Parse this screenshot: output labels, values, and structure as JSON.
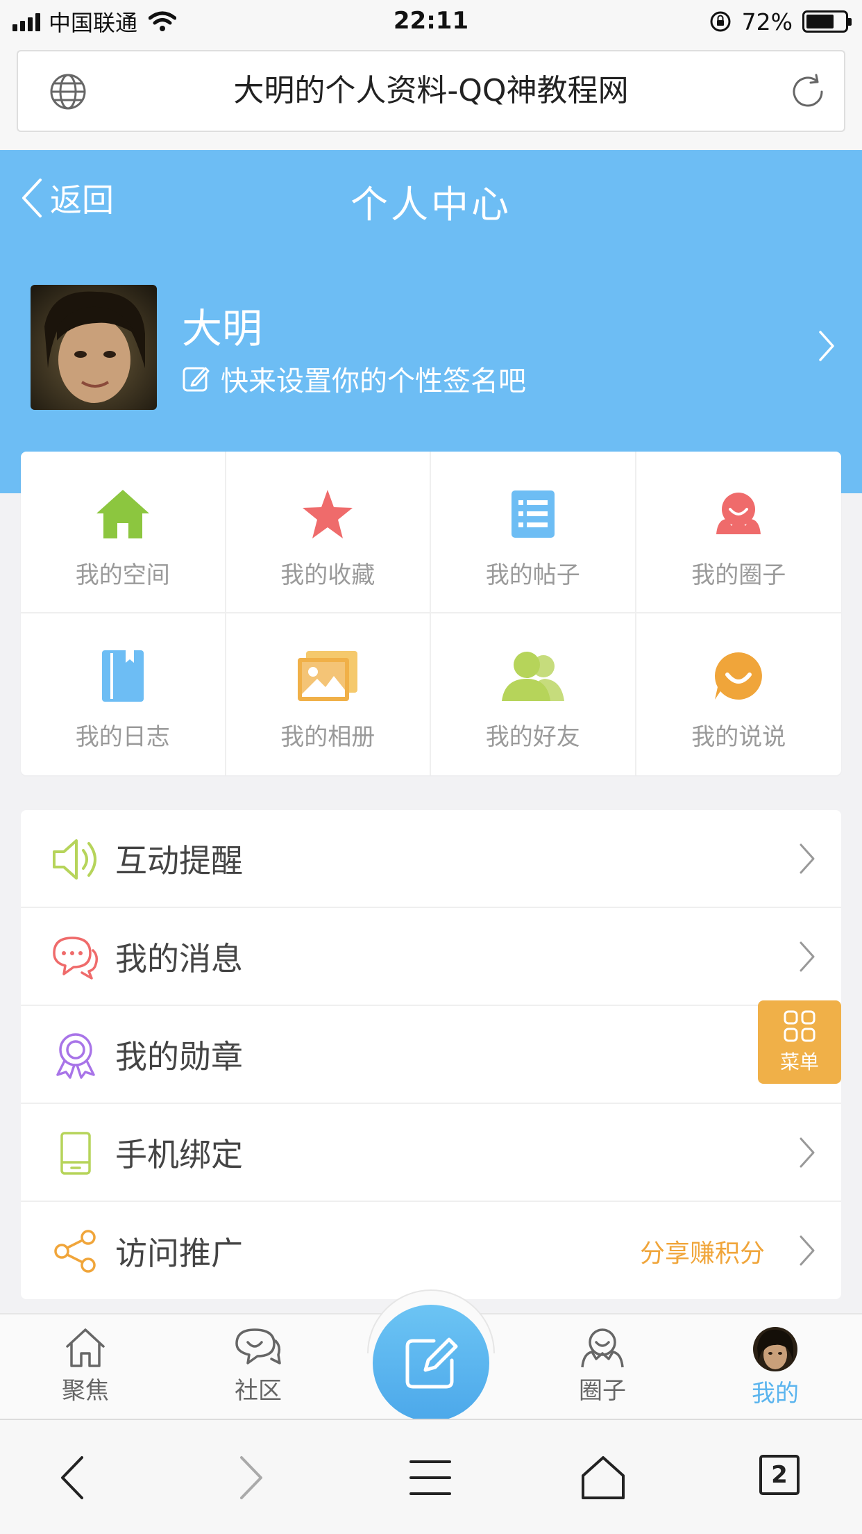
{
  "status_bar": {
    "carrier": "中国联通",
    "time": "22:11",
    "battery_percent": "72%",
    "battery_level": 0.72
  },
  "address_bar": {
    "title": "大明的个人资料-QQ神教程网"
  },
  "header": {
    "back_label": "返回",
    "title": "个人中心",
    "username": "大明",
    "signature_prompt": "快来设置你的个性签名吧"
  },
  "grid": [
    {
      "label": "我的空间",
      "icon": "home-icon",
      "color": "#8cc63f"
    },
    {
      "label": "我的收藏",
      "icon": "star-icon",
      "color": "#ef6b6b"
    },
    {
      "label": "我的帖子",
      "icon": "list-icon",
      "color": "#6dbdf4"
    },
    {
      "label": "我的圈子",
      "icon": "circle-people-icon",
      "color": "#ef6b6b"
    },
    {
      "label": "我的日志",
      "icon": "notebook-icon",
      "color": "#6dbdf4"
    },
    {
      "label": "我的相册",
      "icon": "photo-icon",
      "color": "#f0b048"
    },
    {
      "label": "我的好友",
      "icon": "friends-icon",
      "color": "#b6d45a"
    },
    {
      "label": "我的说说",
      "icon": "smile-bubble-icon",
      "color": "#f0a53a"
    }
  ],
  "list": [
    {
      "label": "互动提醒",
      "icon": "speaker-icon",
      "color": "#b6d45a",
      "extra": ""
    },
    {
      "label": "我的消息",
      "icon": "chat-bubbles-icon",
      "color": "#ef6b6b",
      "extra": ""
    },
    {
      "label": "我的勋章",
      "icon": "medal-icon",
      "color": "#a874e8",
      "extra": ""
    },
    {
      "label": "手机绑定",
      "icon": "phone-icon",
      "color": "#b6d45a",
      "extra": ""
    },
    {
      "label": "访问推广",
      "icon": "share-icon",
      "color": "#f0a53a",
      "extra": "分享赚积分"
    }
  ],
  "float_menu": {
    "label": "菜单",
    "color": "#f0b048"
  },
  "tabbar": [
    {
      "label": "聚焦",
      "icon": "house-outline-icon"
    },
    {
      "label": "社区",
      "icon": "chat-outline-icon"
    },
    {
      "label": "圈子",
      "icon": "circle-outline-icon"
    },
    {
      "label": "我的",
      "icon": "avatar-icon",
      "active": true
    }
  ],
  "browser": {
    "tab_count": "2"
  },
  "colors": {
    "accent_blue": "#6dbdf4",
    "active_tab": "#5ab4ee",
    "highlight_orange": "#f0a53a"
  }
}
